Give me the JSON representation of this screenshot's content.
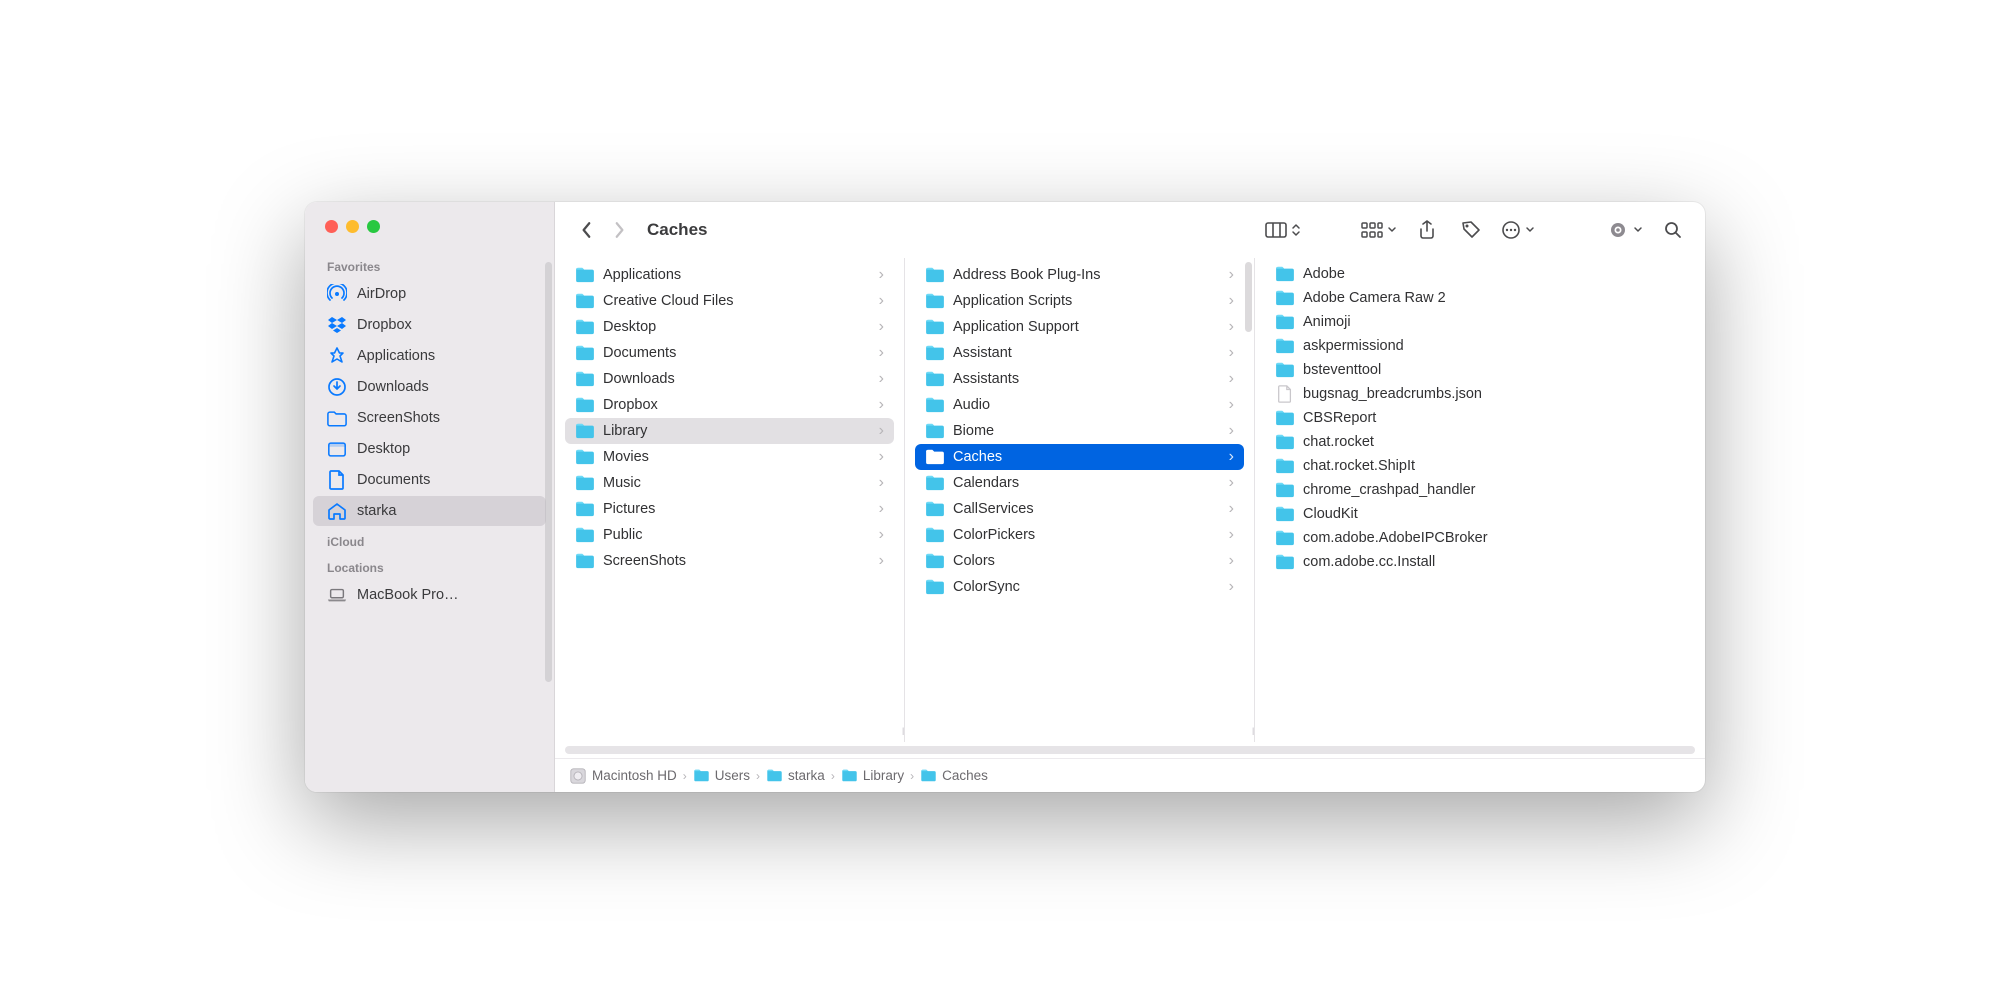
{
  "window": {
    "title": "Caches"
  },
  "sidebar": {
    "sections": [
      {
        "label": "Favorites",
        "items": [
          {
            "icon": "airdrop",
            "label": "AirDrop"
          },
          {
            "icon": "dropbox",
            "label": "Dropbox"
          },
          {
            "icon": "apps",
            "label": "Applications"
          },
          {
            "icon": "downloads",
            "label": "Downloads"
          },
          {
            "icon": "folder",
            "label": "ScreenShots"
          },
          {
            "icon": "desktop",
            "label": "Desktop"
          },
          {
            "icon": "doc",
            "label": "Documents"
          },
          {
            "icon": "home",
            "label": "starka",
            "selected": true
          }
        ]
      },
      {
        "label": "iCloud",
        "items": []
      },
      {
        "label": "Locations",
        "items": [
          {
            "icon": "laptop",
            "label": "MacBook Pro…",
            "grey": true
          }
        ]
      }
    ]
  },
  "columns": [
    {
      "items": [
        {
          "label": "Applications",
          "arrow": true
        },
        {
          "label": "Creative Cloud Files",
          "arrow": true
        },
        {
          "label": "Desktop",
          "arrow": true
        },
        {
          "label": "Documents",
          "arrow": true
        },
        {
          "label": "Downloads",
          "arrow": true
        },
        {
          "label": "Dropbox",
          "arrow": true
        },
        {
          "label": "Library",
          "arrow": true,
          "sel": "grey"
        },
        {
          "label": "Movies",
          "arrow": true
        },
        {
          "label": "Music",
          "arrow": true
        },
        {
          "label": "Pictures",
          "arrow": true
        },
        {
          "label": "Public",
          "arrow": true
        },
        {
          "label": "ScreenShots",
          "arrow": true
        }
      ]
    },
    {
      "scroll": true,
      "items": [
        {
          "label": "Address Book Plug-Ins",
          "arrow": true
        },
        {
          "label": "Application Scripts",
          "arrow": true
        },
        {
          "label": "Application Support",
          "arrow": true
        },
        {
          "label": "Assistant",
          "arrow": true
        },
        {
          "label": "Assistants",
          "arrow": true
        },
        {
          "label": "Audio",
          "arrow": true
        },
        {
          "label": "Biome",
          "arrow": true
        },
        {
          "label": "Caches",
          "arrow": true,
          "sel": "blue"
        },
        {
          "label": "Calendars",
          "arrow": true
        },
        {
          "label": "CallServices",
          "arrow": true
        },
        {
          "label": "ColorPickers",
          "arrow": true
        },
        {
          "label": "Colors",
          "arrow": true
        },
        {
          "label": "ColorSync",
          "arrow": true
        }
      ]
    },
    {
      "items": [
        {
          "label": "Adobe"
        },
        {
          "label": "Adobe Camera Raw 2"
        },
        {
          "label": "Animoji"
        },
        {
          "label": "askpermissiond"
        },
        {
          "label": "bsteventtool"
        },
        {
          "label": "bugsnag_breadcrumbs.json",
          "file": true
        },
        {
          "label": "CBSReport"
        },
        {
          "label": "chat.rocket"
        },
        {
          "label": "chat.rocket.ShipIt"
        },
        {
          "label": "chrome_crashpad_handler"
        },
        {
          "label": "CloudKit"
        },
        {
          "label": "com.adobe.AdobeIPCBroker"
        },
        {
          "label": "com.adobe.cc.Install"
        }
      ]
    }
  ],
  "pathbar": [
    {
      "icon": "disk",
      "label": "Macintosh HD"
    },
    {
      "icon": "folder",
      "label": "Users"
    },
    {
      "icon": "folder",
      "label": "starka"
    },
    {
      "icon": "folder",
      "label": "Library"
    },
    {
      "icon": "folder",
      "label": "Caches"
    }
  ]
}
